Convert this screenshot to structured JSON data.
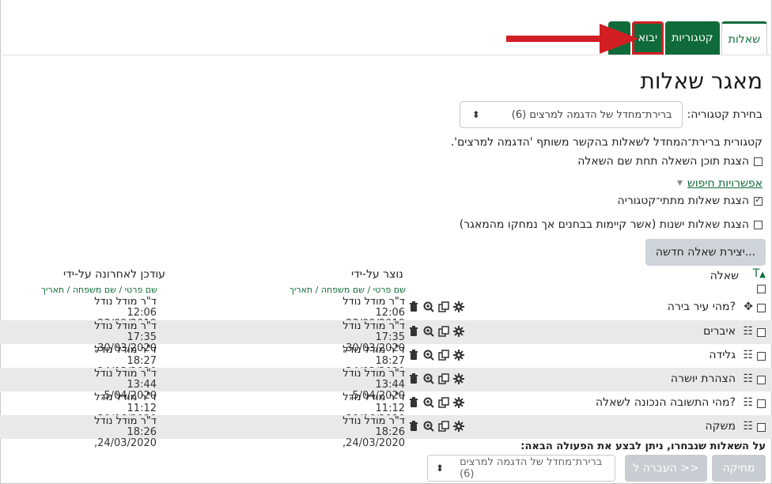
{
  "tabs": [
    {
      "label": "שאלות",
      "state": "active"
    },
    {
      "label": "קטגוריות",
      "state": "green"
    },
    {
      "label": "יבוא",
      "state": "green-highlight"
    },
    {
      "label": "",
      "state": "green-stub"
    }
  ],
  "page_title": "מאגר שאלות",
  "category": {
    "label": "בחירת קטגוריה:",
    "selected": "ברירת־מחדל של הדגמה למרצים (6)"
  },
  "category_description": "קטגורית ברירת־המחדל לשאלות בהקשר משותף 'הדגמה למרצים'.",
  "options": {
    "show_question_text": "הצגת תוכן השאלה תחת שם השאלה",
    "search_options": "אפשרויות חיפוש",
    "show_subcategories": "הצגת שאלות מתתי־קטגוריה",
    "show_old": "הצגת שאלות ישנות (אשר קיימות בבחנים אך נמחקו מהמאגר)"
  },
  "create_button": "יצירת שאלה חדשה...",
  "table": {
    "col_question": "שאלה",
    "col_type": "T",
    "col_created": "נוצר על-ידי",
    "col_created_sub": "שם פרטי / שם משפחה / תאריך",
    "col_modified": "עודכן לאחרונה על-ידי",
    "col_modified_sub": "שם פרטי / שם משפחה / תאריך",
    "rows": [
      {
        "name": "מהי עיר בירה?",
        "icon": "move-icon",
        "created_by": "ד\"ר מודל נודל",
        "created_date": "12:06 ,23/09/2019",
        "modified_by": "ד\"ר מודל נודל",
        "modified_date": "12:06 ,23/09/2019"
      },
      {
        "name": "איברים",
        "icon": "list-icon",
        "created_by": "ד\"ר מודל נודל",
        "created_date": "17:35 ,30/03/2020",
        "modified_by": "ד\"ר מודל נודל",
        "modified_date": "17:35 ,30/03/2020"
      },
      {
        "name": "גלידה",
        "icon": "list-icon",
        "created_by": "ד\"ר מודל נודל",
        "created_date": "18:27 ,24/03/2020",
        "modified_by": "ד\"ר מודל נודל",
        "modified_date": "18:27 ,24/03/2020"
      },
      {
        "name": "הצהרת יושרה",
        "icon": "list-icon",
        "created_by": "ד\"ר מודל נודל",
        "created_date": "13:44 ,5/04/2020",
        "modified_by": "ד\"ר מודל נודל",
        "modified_date": "13:44 ,5/04/2020"
      },
      {
        "name": "מהי התשובה הנכונה לשאלה?",
        "icon": "list-icon",
        "created_by": "ד\"ר מודל נודל",
        "created_date": "11:12 ,30/06/2020",
        "modified_by": "ד\"ר מודל נודל",
        "modified_date": "11:12 ,30/06/2020"
      },
      {
        "name": "משקה",
        "icon": "list-icon",
        "created_by": "ד\"ר מודל נודל",
        "created_date": "18:26 ,24/03/2020",
        "modified_by": "ד\"ר מודל נודל",
        "modified_date": "18:26 ,24/03/2020"
      }
    ]
  },
  "bulk": {
    "label": "על השאלות שנבחרו, ניתן לבצע את הפעולה הבאה:",
    "delete": "מחיקה",
    "move": "העברה ל >>",
    "target": "ברירת־מחדל של הדגמה למרצים (6)"
  },
  "colors": {
    "accent": "#0f6b3a",
    "highlight": "#d11f24"
  }
}
